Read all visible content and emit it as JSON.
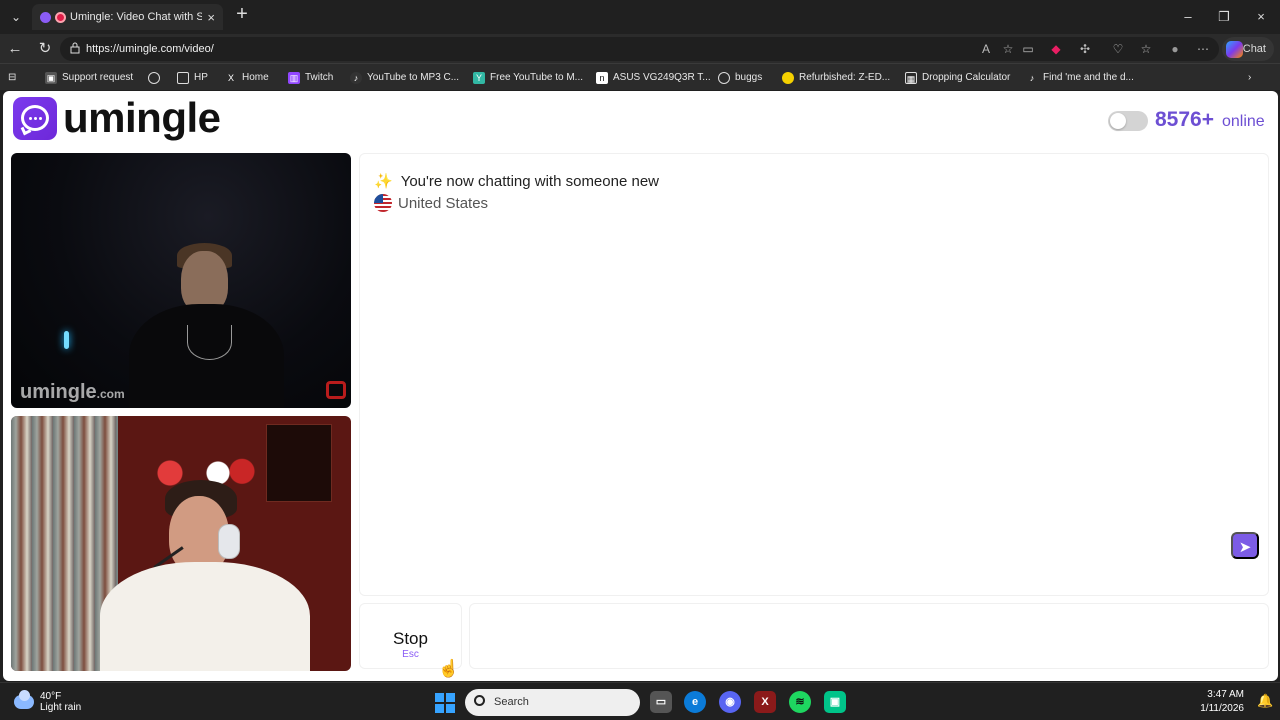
{
  "browser": {
    "tab": {
      "title": "Umingle: Video Chat with Stra"
    },
    "address": {
      "url": "https://umingle.com/video/"
    },
    "chat_button": "Chat",
    "window_controls": {
      "minimize": "–",
      "restore": "❐",
      "close": "×"
    },
    "bookmarks": [
      {
        "label": "Support request",
        "icon": "bookmark-icon"
      },
      {
        "label": "",
        "icon": "globe-icon"
      },
      {
        "label": "HP",
        "icon": "folder-icon"
      },
      {
        "label": "Home",
        "icon": "x-logo-icon"
      },
      {
        "label": "Twitch",
        "icon": "twitch-icon"
      },
      {
        "label": "YouTube to MP3 C...",
        "icon": "music-icon"
      },
      {
        "label": "Free YouTube to M...",
        "icon": "ytb-icon"
      },
      {
        "label": "ASUS VG249Q3R T...",
        "icon": "notion-icon"
      },
      {
        "label": "buggs",
        "icon": "globe-icon"
      },
      {
        "label": "Refurbished: Z-ED...",
        "icon": "lemon-icon"
      },
      {
        "label": "Dropping Calculator",
        "icon": "calculator-icon"
      },
      {
        "label": "Find 'me and the d...",
        "icon": "tiktok-icon"
      }
    ]
  },
  "page": {
    "brand": {
      "name": "umingle"
    },
    "online": {
      "count": "8576+",
      "label": "online"
    },
    "remote_video": {
      "watermark": "umingle",
      "watermark_suffix": ".com"
    },
    "chat": {
      "status": "You're now chatting with someone new",
      "country": "United States"
    },
    "controls": {
      "stop_label": "Stop",
      "stop_key": "Esc",
      "input_placeholder": "",
      "send_icon": "send-icon"
    }
  },
  "taskbar": {
    "weather_temp": "40°F",
    "weather_desc": "Light rain",
    "search_placeholder": "Search",
    "time": "3:47 AM",
    "date": "1/11/2026"
  },
  "colors": {
    "brand_purple": "#7c5ce6",
    "online_purple": "#6d4fd3",
    "browser_dark": "#202020"
  }
}
